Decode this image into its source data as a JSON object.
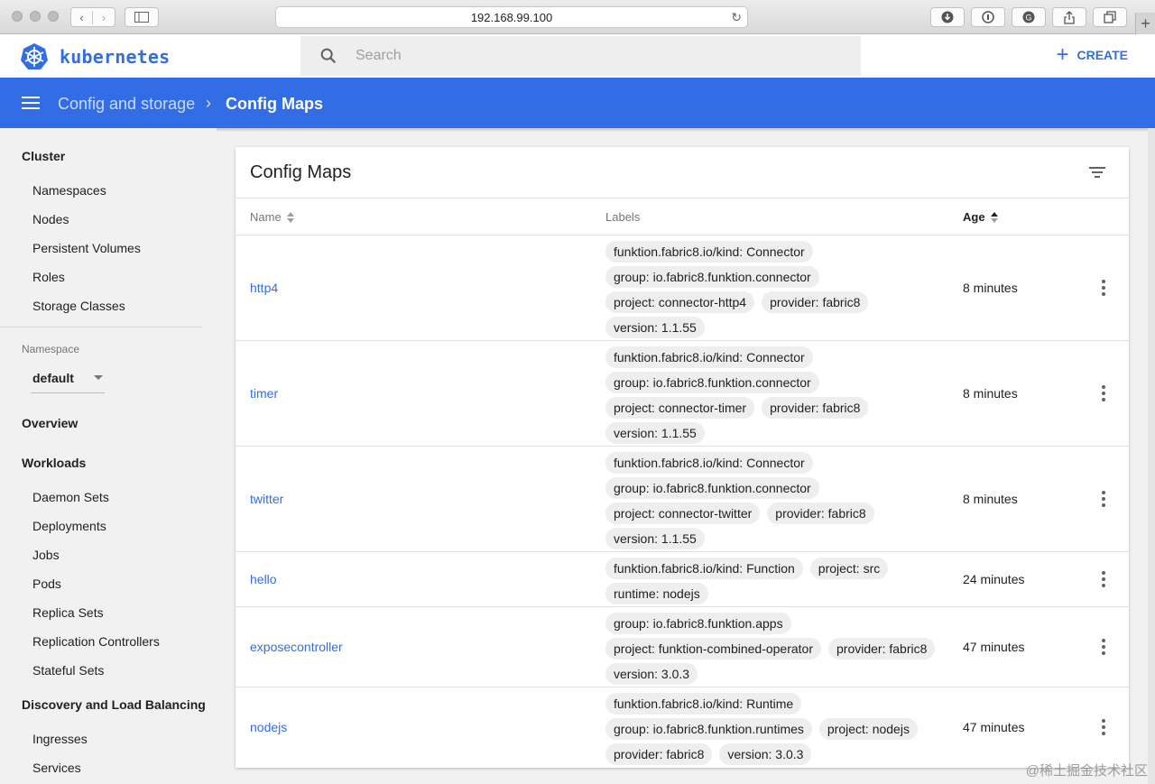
{
  "browser": {
    "url": "192.168.99.100"
  },
  "header": {
    "brand": "kubernetes",
    "search_placeholder": "Search",
    "create_label": "CREATE"
  },
  "breadcrumb": {
    "parent": "Config and storage",
    "separator": "›",
    "current": "Config Maps"
  },
  "sidebar": {
    "cluster_title": "Cluster",
    "cluster_items": [
      "Namespaces",
      "Nodes",
      "Persistent Volumes",
      "Roles",
      "Storage Classes"
    ],
    "namespace_label": "Namespace",
    "namespace_value": "default",
    "overview": "Overview",
    "workloads_title": "Workloads",
    "workloads_items": [
      "Daemon Sets",
      "Deployments",
      "Jobs",
      "Pods",
      "Replica Sets",
      "Replication Controllers",
      "Stateful Sets"
    ],
    "discovery_title": "Discovery and Load Balancing",
    "discovery_items": [
      "Ingresses",
      "Services"
    ]
  },
  "card": {
    "title": "Config Maps",
    "columns": {
      "name": "Name",
      "labels": "Labels",
      "age": "Age"
    },
    "rows": [
      {
        "name": "http4",
        "labels": [
          "funktion.fabric8.io/kind: Connector",
          "group: io.fabric8.funktion.connector",
          "project: connector-http4",
          "provider: fabric8",
          "version: 1.1.55"
        ],
        "age": "8 minutes"
      },
      {
        "name": "timer",
        "labels": [
          "funktion.fabric8.io/kind: Connector",
          "group: io.fabric8.funktion.connector",
          "project: connector-timer",
          "provider: fabric8",
          "version: 1.1.55"
        ],
        "age": "8 minutes"
      },
      {
        "name": "twitter",
        "labels": [
          "funktion.fabric8.io/kind: Connector",
          "group: io.fabric8.funktion.connector",
          "project: connector-twitter",
          "provider: fabric8",
          "version: 1.1.55"
        ],
        "age": "8 minutes"
      },
      {
        "name": "hello",
        "labels": [
          "funktion.fabric8.io/kind: Function",
          "project: src",
          "runtime: nodejs"
        ],
        "age": "24 minutes"
      },
      {
        "name": "exposecontroller",
        "labels": [
          "group: io.fabric8.funktion.apps",
          "project: funktion-combined-operator",
          "provider: fabric8",
          "version: 3.0.3"
        ],
        "age": "47 minutes"
      },
      {
        "name": "nodejs",
        "labels": [
          "funktion.fabric8.io/kind: Runtime",
          "group: io.fabric8.funktion.runtimes",
          "project: nodejs",
          "provider: fabric8",
          "version: 3.0.3"
        ],
        "age": "47 minutes"
      }
    ]
  },
  "watermark": "@稀土掘金技术社区"
}
